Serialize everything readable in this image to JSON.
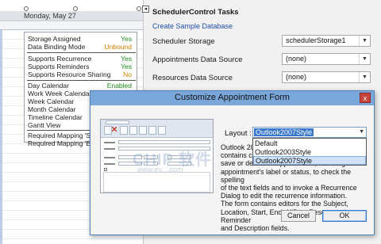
{
  "scheduler": {
    "date_header": "Monday, May 27"
  },
  "smart_panel": {
    "rows": [
      {
        "label": "Storage Assigned",
        "value": "Yes",
        "status": "yes"
      },
      {
        "label": "Data Binding Mode",
        "value": "Unbound",
        "status": "unbound"
      },
      {
        "label": "Supports Recurrence",
        "value": "Yes",
        "status": "yes"
      },
      {
        "label": "Supports Reminders",
        "value": "Yes",
        "status": "yes"
      },
      {
        "label": "Supports Resource Sharing",
        "value": "No",
        "status": "no"
      },
      {
        "label": "Day Calendar",
        "value": "Enabled",
        "status": "yes"
      },
      {
        "label": "Work Week Calendar",
        "value": "",
        "status": ""
      },
      {
        "label": "Week Calendar",
        "value": "",
        "status": ""
      },
      {
        "label": "Month Calendar",
        "value": "",
        "status": ""
      },
      {
        "label": "Timeline Calendar",
        "value": "",
        "status": ""
      },
      {
        "label": "Gantt View",
        "value": "",
        "status": ""
      },
      {
        "label": "Required Mapping 'St",
        "value": "",
        "status": ""
      },
      {
        "label": "Required Mapping 'En",
        "value": "",
        "status": ""
      }
    ]
  },
  "tasks": {
    "title": "SchedulerControl Tasks",
    "collapse_glyph": "◂",
    "create_link": "Create Sample Database",
    "storage_label": "Scheduler Storage",
    "storage_value": "schedulerStorage1",
    "appointments_label": "Appointments  Data Source",
    "appointments_value": "(none)",
    "resources_label": "Resources  Data Source",
    "resources_value": "(none)",
    "dropdown_arrow": "▼"
  },
  "dialog": {
    "title": "Customize Appointment Form",
    "close_glyph": "x",
    "layout_label": "Layout :",
    "layout_selected": "Outlook2007Style",
    "layout_options": [
      "Default",
      "Outlook2003Style",
      "Outlook2007Style"
    ],
    "highlighted_option_index": 2,
    "description_partial": [
      "Outlook 20",
      "contains c",
      "save or delete an appointment, to change the",
      "appointment's label or status, to check the spelling",
      "of the text fields and to invoke a Recurrence",
      "Dialog to edit the recurrence information.",
      "The form contains editors for the Subject,",
      "Location, Start, End, AllDay, Resource, Reminder",
      "and Description fields."
    ],
    "watermark": "CHIP 软件",
    "watermark_url": "www.ev....com",
    "cancel_label": "Cancel",
    "ok_label": "OK"
  },
  "colors": {
    "titlebar": "#7aa7d9",
    "link": "#1f4fa8",
    "yes": "#1e8a1e",
    "unbound": "#d08000",
    "selection": "#3a78c9",
    "close": "#c7453a"
  }
}
